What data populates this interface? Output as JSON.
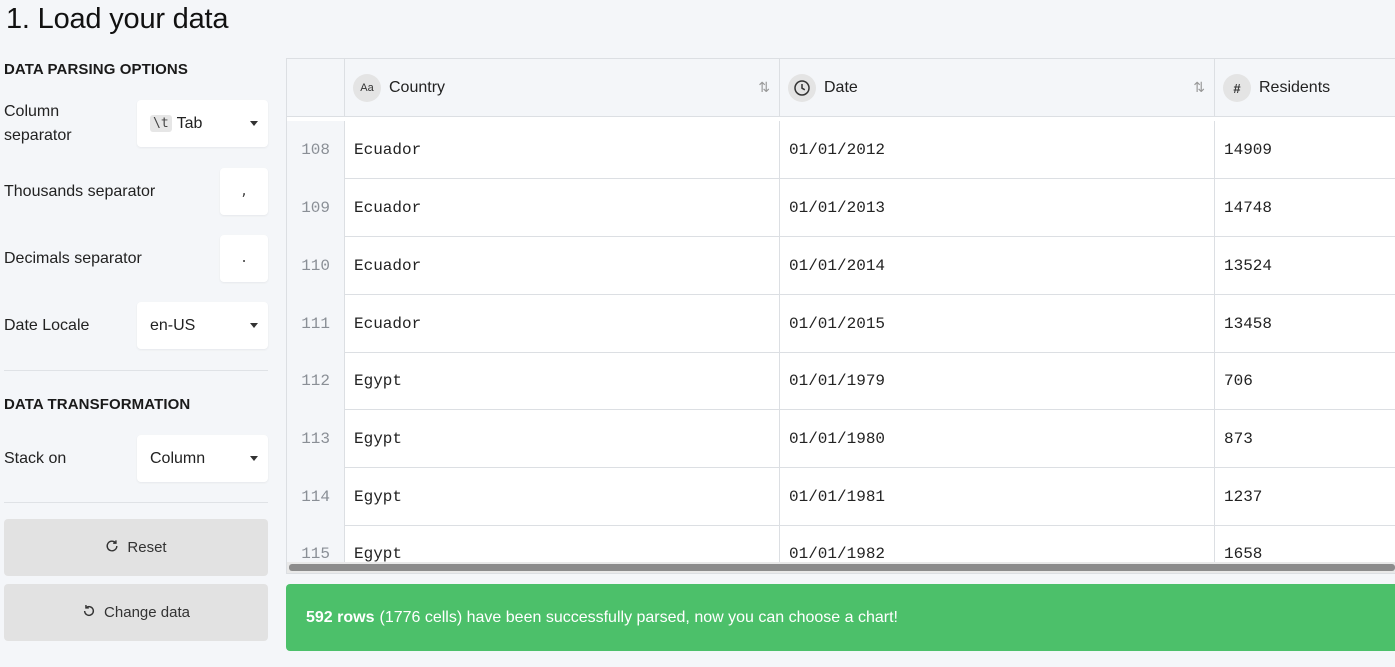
{
  "page": {
    "title": "1. Load your data"
  },
  "parsing": {
    "title": "DATA PARSING OPTIONS",
    "column_separator": {
      "label": "Column separator",
      "chip": "\\t",
      "value": "Tab"
    },
    "thousands_separator": {
      "label": "Thousands separator",
      "value": ","
    },
    "decimals_separator": {
      "label": "Decimals separator",
      "value": "."
    },
    "date_locale": {
      "label": "Date Locale",
      "value": "en-US"
    }
  },
  "transformation": {
    "title": "DATA TRANSFORMATION",
    "stack_on": {
      "label": "Stack on",
      "value": "Column"
    }
  },
  "buttons": {
    "reset": "Reset",
    "change_data": "Change data"
  },
  "table": {
    "columns": [
      {
        "badge": "Aa",
        "label": "Country",
        "sort_icon": "⇅"
      },
      {
        "badge": "clock",
        "label": "Date",
        "sort_icon": "⇅"
      },
      {
        "badge": "#",
        "label": "Residents"
      }
    ],
    "rows": [
      {
        "idx": "108",
        "country": "Ecuador",
        "date": "01/01/2012",
        "residents": "14909"
      },
      {
        "idx": "109",
        "country": "Ecuador",
        "date": "01/01/2013",
        "residents": "14748"
      },
      {
        "idx": "110",
        "country": "Ecuador",
        "date": "01/01/2014",
        "residents": "13524"
      },
      {
        "idx": "111",
        "country": "Ecuador",
        "date": "01/01/2015",
        "residents": "13458"
      },
      {
        "idx": "112",
        "country": "Egypt",
        "date": "01/01/1979",
        "residents": "706"
      },
      {
        "idx": "113",
        "country": "Egypt",
        "date": "01/01/1980",
        "residents": "873"
      },
      {
        "idx": "114",
        "country": "Egypt",
        "date": "01/01/1981",
        "residents": "1237"
      },
      {
        "idx": "115",
        "country": "Egypt",
        "date": "01/01/1982",
        "residents": "1658"
      }
    ]
  },
  "status": {
    "rows_bold": "592 rows",
    "message": "(1776 cells) have been successfully parsed, now you can choose a chart!",
    "color": "#4cc06a"
  }
}
